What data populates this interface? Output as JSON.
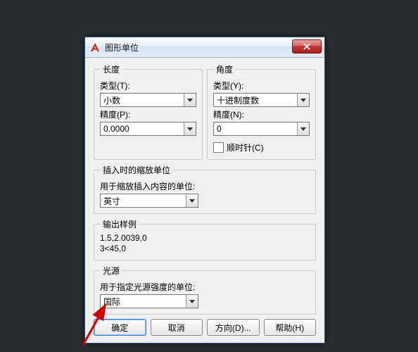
{
  "dialog": {
    "title": "图形单位",
    "close_icon": "x"
  },
  "length": {
    "legend": "长度",
    "type_label": "类型(T):",
    "type_value": "小数",
    "precision_label": "精度(P):",
    "precision_value": "0.0000"
  },
  "angle": {
    "legend": "角度",
    "type_label": "类型(Y):",
    "type_value": "十进制度数",
    "precision_label": "精度(N):",
    "precision_value": "0",
    "clockwise_label": "顺时针(C)"
  },
  "insert_scale": {
    "legend": "插入时的缩放单位",
    "desc": "用于缩放插入内容的单位:",
    "value": "英寸"
  },
  "sample": {
    "legend": "输出样例",
    "text": "1.5,2.0039,0\n3<45,0"
  },
  "light": {
    "legend": "光源",
    "desc": "用于指定光源强度的单位:",
    "value": "国际"
  },
  "buttons": {
    "ok": "确定",
    "cancel": "取消",
    "direction": "方向(D)...",
    "help": "帮助(H)"
  }
}
